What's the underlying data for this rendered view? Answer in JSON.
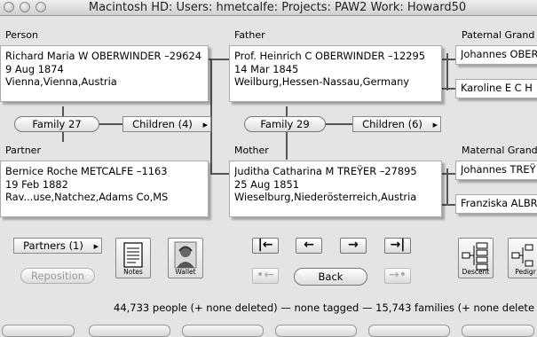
{
  "window": {
    "title": "Macintosh HD: Users: hmetcalfe: Projects: PAW2 Work: Howard50"
  },
  "labels": {
    "person": "Person",
    "father": "Father",
    "paternal": "Paternal Grand",
    "partner": "Partner",
    "mother": "Mother",
    "maternal": "Maternal Grand"
  },
  "person": {
    "name": "Richard Maria W OBERWINDER –29624",
    "date": "9 Aug 1874",
    "place": "Vienna,Vienna,Austria"
  },
  "father": {
    "name": "Prof. Heinrich C OBERWINDER –12295",
    "date": "14 Mar 1845",
    "place": "Weilburg,Hessen-Nassau,Germany"
  },
  "partner": {
    "name": "Bernice Roche METCALFE –1163",
    "date": "19 Feb 1882",
    "place": "Rav...use,Natchez,Adams Co,MS"
  },
  "mother": {
    "name": "Juditha Catharina M TREŸER –27895",
    "date": "25 Aug 1851",
    "place": "Wieselburg,Niederösterreich,Austria"
  },
  "grandparents": {
    "paternal_1": "Johannes OBER",
    "paternal_2": "Karoline E C H",
    "maternal_1": "Johannes TREŸ",
    "maternal_2": "Franziska ALBR"
  },
  "buttons": {
    "family_27": "Family 27",
    "children_4": "Children (4)",
    "family_29": "Family 29",
    "children_6": "Children (6)",
    "partners": "Partners (1)",
    "reposition": "Reposition",
    "notes": "Notes",
    "wallet": "Wallet",
    "back": "Back",
    "descent": "Descent",
    "pedigree": "Pedigr",
    "nav_first": "|←",
    "nav_prev": "←",
    "nav_next": "→",
    "nav_last": "→|",
    "nav_hist_back": "•←",
    "nav_hist_fwd": "→•"
  },
  "status": "44,733 people (+ none deleted) — none tagged — 15,743 families (+ none delete"
}
